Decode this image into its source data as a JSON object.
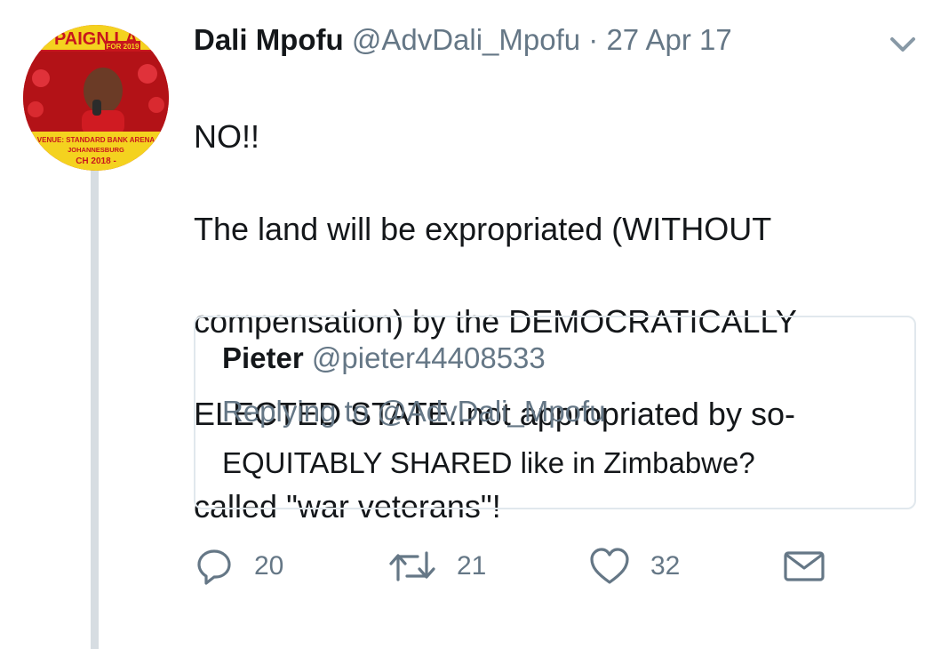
{
  "tweet": {
    "author_name": "Dali Mpofu",
    "author_handle": "@AdvDali_Mpofu",
    "separator": "·",
    "date": "27 Apr 17",
    "text_lines": [
      "NO!!",
      "The land will be expropriated (WITHOUT",
      "compensation) by the DEMOCRATICALLY",
      "ELECTED STATE..not appropriated by so-",
      "called \"war veterans\"!"
    ],
    "avatar": {
      "icon": "avatar-poster-image",
      "banner_text_top": "PAIGN LA",
      "banner_text_sub": "FOR 2019",
      "venue_line1": "VENUE: STANDARD BANK ARENA",
      "venue_line2": "JOHANNESBURG",
      "venue_line3": "CH 2018 -",
      "colors": {
        "poster_red": "#c8161d",
        "poster_yellow": "#f4d21f"
      }
    }
  },
  "quoted_tweet": {
    "author_name": "Pieter",
    "author_handle": "@pieter44408533",
    "replying_to": "Replying to @AdvDali_Mpofu",
    "text": "EQUITABLY SHARED like in Zimbabwe?"
  },
  "actions": {
    "reply": {
      "icon": "reply-icon",
      "count": "20"
    },
    "retweet": {
      "icon": "retweet-icon",
      "count": "21"
    },
    "like": {
      "icon": "heart-icon",
      "count": "32"
    },
    "message": {
      "icon": "envelope-icon"
    }
  },
  "colors": {
    "text_primary": "#14171a",
    "text_secondary": "#657786",
    "border": "#e1e8ed",
    "thread_line": "#d7dde2"
  }
}
